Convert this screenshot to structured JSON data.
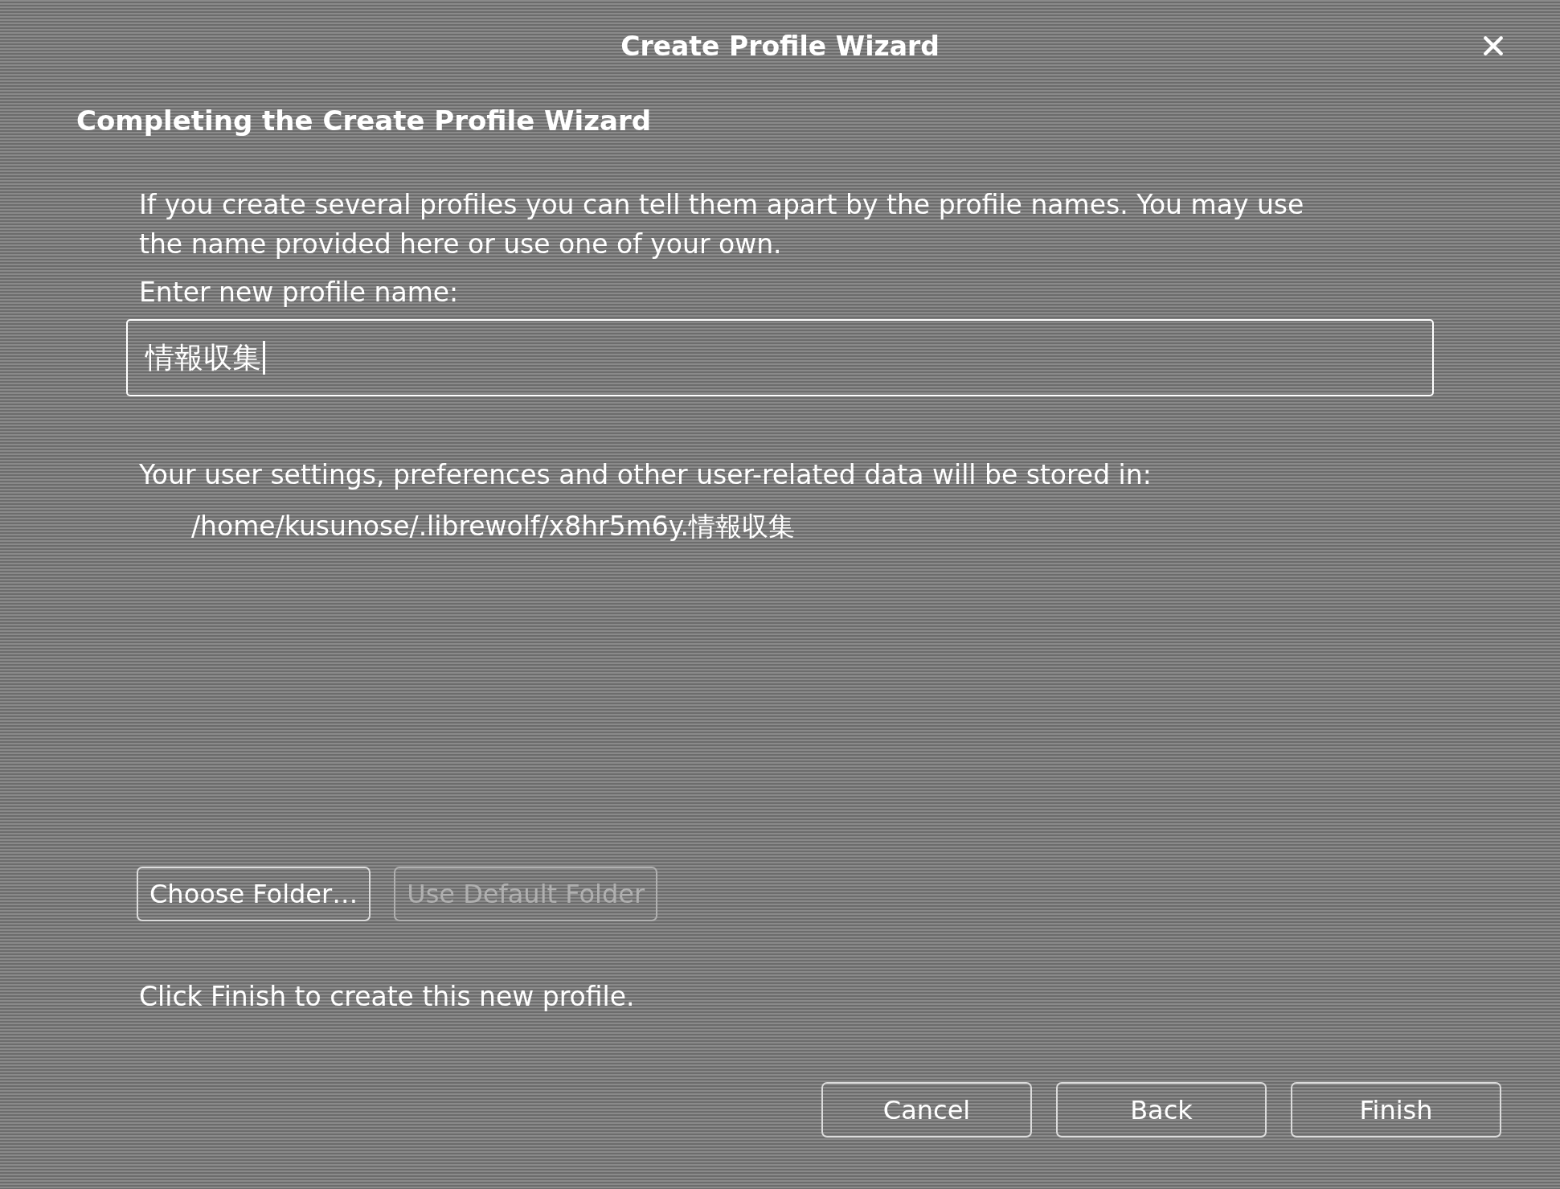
{
  "window": {
    "title": "Create Profile Wizard"
  },
  "heading": "Completing the Create Profile Wizard",
  "intro": "If you create several profiles you can tell them apart by the profile names. You may use the name provided here or use one of your own.",
  "name_field": {
    "label": "Enter new profile name:",
    "value": "情報収集",
    "focused": true
  },
  "storage": {
    "label": "Your user settings, preferences and other user-related data will be stored in:",
    "path": "/home/kusunose/.librewolf/x8hr5m6y.情報収集"
  },
  "folder_buttons": [
    {
      "label": "Choose Folder…",
      "disabled": false
    },
    {
      "label": "Use Default Folder",
      "disabled": true
    }
  ],
  "finish_note": "Click Finish to create this new profile.",
  "footer_buttons": [
    {
      "label": "Cancel",
      "disabled": false
    },
    {
      "label": "Back",
      "disabled": false
    },
    {
      "label": "Finish",
      "disabled": false
    }
  ]
}
